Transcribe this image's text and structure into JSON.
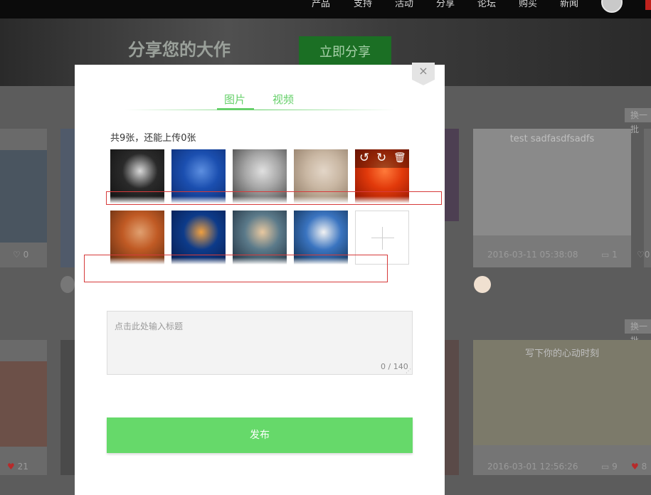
{
  "nav": {
    "items": [
      "产品",
      "支持",
      "活动",
      "分享",
      "论坛",
      "购买",
      "新闻"
    ]
  },
  "banner": {
    "title": "分享您的大作",
    "subtitle": "",
    "share_button": "立即分享"
  },
  "background_cards": {
    "swap_label_1": "换一批",
    "swap_label_2": "换一批",
    "card_title_1": "test sadfasdfsadfs",
    "card_title_2": "写下你的心动时刻",
    "date_1": "2016-03-11 05:38:08",
    "date_2": "2016-03-01 12:56:26",
    "likes_left_1": "0",
    "likes_left_2": "21",
    "comments_1": "1",
    "likes_right_1": "0",
    "comments_2": "9",
    "likes_right_2": "8"
  },
  "modal": {
    "close_icon": "×",
    "tabs": [
      {
        "label": "图片",
        "active": true
      },
      {
        "label": "视频",
        "active": false
      }
    ],
    "count_text": "共9张，还能上传0张",
    "images": [
      {
        "name": "portrait-bw",
        "colors": [
          "#111111",
          "#2a2a2a",
          "#d9d9d9"
        ]
      },
      {
        "name": "blue-water",
        "colors": [
          "#0b2a6e",
          "#1b4fb0",
          "#5d8fe0"
        ]
      },
      {
        "name": "silver-dress",
        "colors": [
          "#3b3b3b",
          "#a6a6a6",
          "#e0e0e0"
        ]
      },
      {
        "name": "child-playing",
        "colors": [
          "#8a7560",
          "#c9b7a3",
          "#e3d6c8"
        ]
      },
      {
        "name": "red-flower",
        "colors": [
          "#8a1200",
          "#e23a0b",
          "#ff7a3a"
        ]
      },
      {
        "name": "desert-rock",
        "colors": [
          "#5c2a10",
          "#c05a24",
          "#e0a070"
        ]
      },
      {
        "name": "jellyfish",
        "colors": [
          "#071a4a",
          "#0d3b8a",
          "#f0a040"
        ]
      },
      {
        "name": "lighthouse",
        "colors": [
          "#1b2a3a",
          "#5b7a8a",
          "#e8c8a0"
        ]
      },
      {
        "name": "penguins",
        "colors": [
          "#0e2a4a",
          "#3a74c0",
          "#f2f2f2"
        ]
      }
    ],
    "tools": {
      "rotate_left": "↺",
      "rotate_right": "↻",
      "delete": "🗑"
    },
    "title_placeholder": "点击此处输入标题",
    "char_count": "0 / 140",
    "publish_label": "发布",
    "accent_color": "#66d96a"
  }
}
